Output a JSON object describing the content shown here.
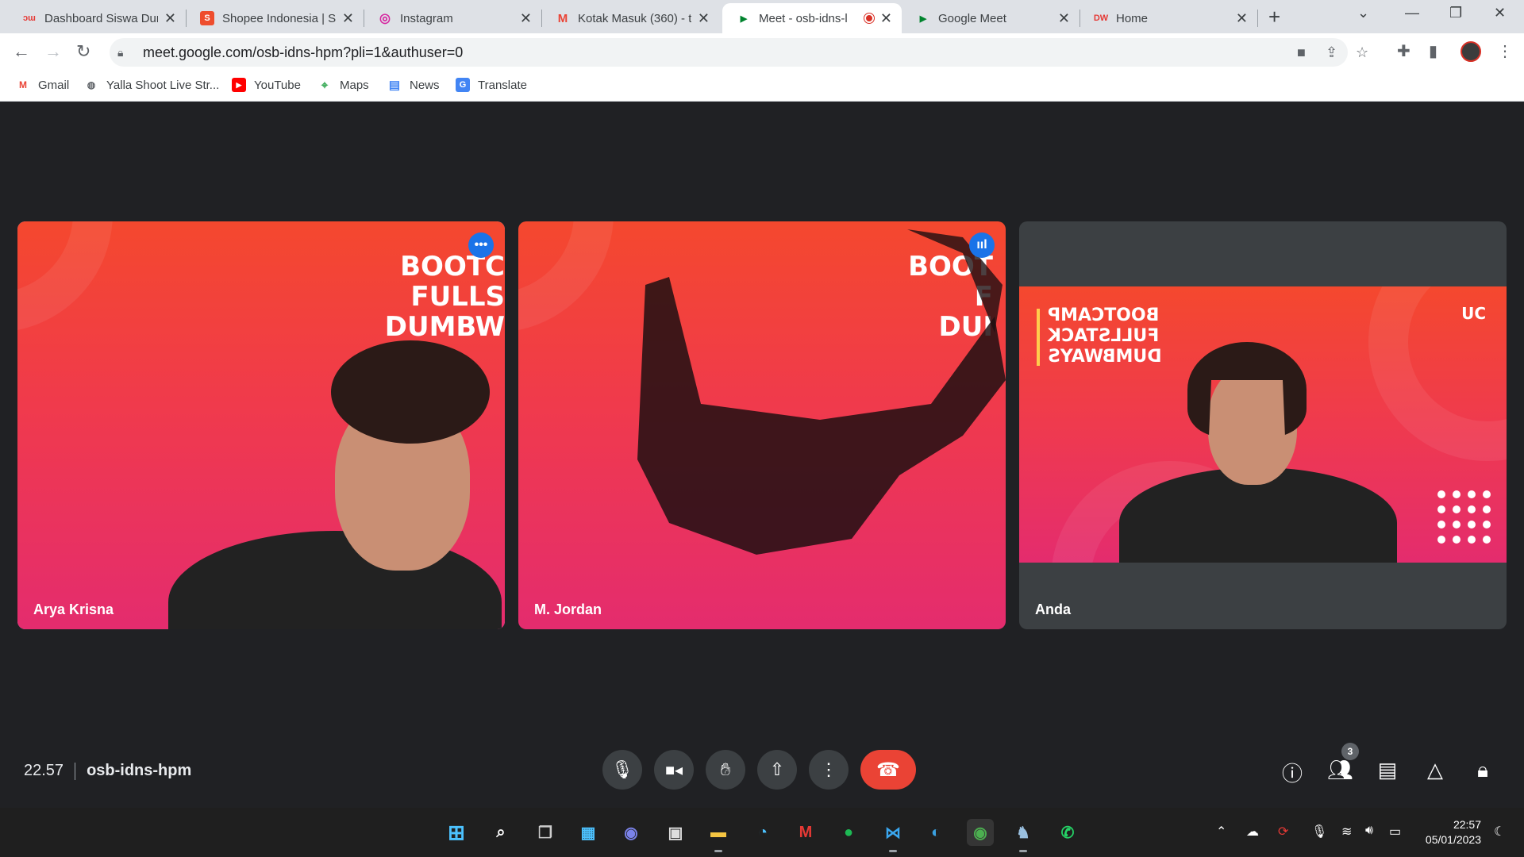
{
  "tabs": [
    {
      "title": "Dashboard Siswa Dun",
      "favicon": "dumbways-icon",
      "fav_text": "ɔɯ",
      "color": "#e53935"
    },
    {
      "title": "Shopee Indonesia | Si",
      "favicon": "shopee-icon",
      "fav_text": "S",
      "color": "#ee4d2d"
    },
    {
      "title": "Instagram",
      "favicon": "instagram-icon",
      "fav_text": "◎",
      "color": "#d6249f"
    },
    {
      "title": "Kotak Masuk (360) - ti",
      "favicon": "gmail-icon",
      "fav_text": "M",
      "color": "#ea4335"
    },
    {
      "title": "Meet - osb-idns-l",
      "favicon": "meet-icon",
      "fav_text": "▶",
      "color": "#00832d"
    },
    {
      "title": "Google Meet",
      "favicon": "meet-icon",
      "fav_text": "▶",
      "color": "#00832d"
    },
    {
      "title": "Home",
      "favicon": "dumbways-icon",
      "fav_text": "DW",
      "color": "#e53935"
    }
  ],
  "address": {
    "url": "meet.google.com/osb-idns-hpm?pli=1&authuser=0"
  },
  "bookmarks": [
    {
      "label": "Gmail",
      "icon": "gmail-icon",
      "glyph": "M",
      "color": "#ea4335"
    },
    {
      "label": "Yalla Shoot Live Str...",
      "icon": "globe-icon",
      "glyph": "◍",
      "color": "#5f6368"
    },
    {
      "label": "YouTube",
      "icon": "youtube-icon",
      "glyph": "▶",
      "color": "#ff0000"
    },
    {
      "label": "Maps",
      "icon": "maps-icon",
      "glyph": "⌖",
      "color": "#34a853"
    },
    {
      "label": "News",
      "icon": "news-icon",
      "glyph": "▤",
      "color": "#4285f4"
    },
    {
      "label": "Translate",
      "icon": "translate-icon",
      "glyph": "G",
      "color": "#4285f4"
    }
  ],
  "participants": [
    {
      "name": "Arya Krisna",
      "badge": "•••",
      "bg_text": "BOOTC\nFULLS\nDUMBW"
    },
    {
      "name": "M. Jordan",
      "badge": "ııl",
      "bg_text": "BOOT\nF\nDUI"
    },
    {
      "name": "Anda",
      "bg_text": "BOOTCAMP\nFULLSTACK\nDUMBWAYS",
      "logo": "UC"
    }
  ],
  "meeting": {
    "time": "22.57",
    "code": "osb-idns-hpm",
    "participant_count": "3"
  },
  "controls": [
    "mic-icon",
    "camera-icon",
    "raise-hand-icon",
    "present-icon",
    "more-icon",
    "end-call-icon"
  ],
  "clock": {
    "time": "22:57",
    "date": "05/01/2023"
  }
}
